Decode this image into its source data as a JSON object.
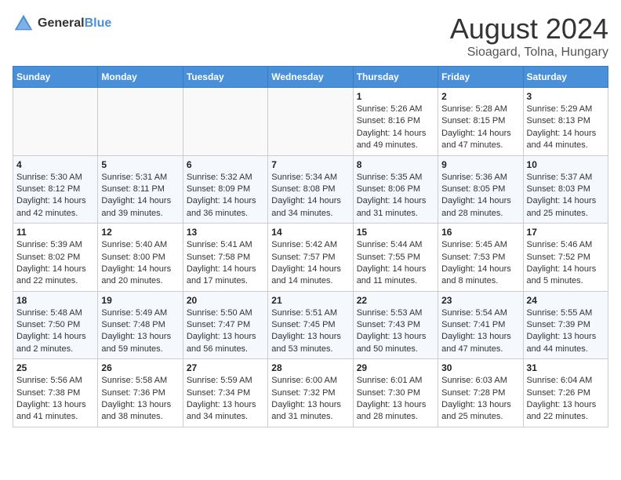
{
  "header": {
    "logo_general": "General",
    "logo_blue": "Blue",
    "title": "August 2024",
    "location": "Sioagard, Tolna, Hungary"
  },
  "weekdays": [
    "Sunday",
    "Monday",
    "Tuesday",
    "Wednesday",
    "Thursday",
    "Friday",
    "Saturday"
  ],
  "weeks": [
    [
      {
        "day": "",
        "info": ""
      },
      {
        "day": "",
        "info": ""
      },
      {
        "day": "",
        "info": ""
      },
      {
        "day": "",
        "info": ""
      },
      {
        "day": "1",
        "info": "Sunrise: 5:26 AM\nSunset: 8:16 PM\nDaylight: 14 hours\nand 49 minutes."
      },
      {
        "day": "2",
        "info": "Sunrise: 5:28 AM\nSunset: 8:15 PM\nDaylight: 14 hours\nand 47 minutes."
      },
      {
        "day": "3",
        "info": "Sunrise: 5:29 AM\nSunset: 8:13 PM\nDaylight: 14 hours\nand 44 minutes."
      }
    ],
    [
      {
        "day": "4",
        "info": "Sunrise: 5:30 AM\nSunset: 8:12 PM\nDaylight: 14 hours\nand 42 minutes."
      },
      {
        "day": "5",
        "info": "Sunrise: 5:31 AM\nSunset: 8:11 PM\nDaylight: 14 hours\nand 39 minutes."
      },
      {
        "day": "6",
        "info": "Sunrise: 5:32 AM\nSunset: 8:09 PM\nDaylight: 14 hours\nand 36 minutes."
      },
      {
        "day": "7",
        "info": "Sunrise: 5:34 AM\nSunset: 8:08 PM\nDaylight: 14 hours\nand 34 minutes."
      },
      {
        "day": "8",
        "info": "Sunrise: 5:35 AM\nSunset: 8:06 PM\nDaylight: 14 hours\nand 31 minutes."
      },
      {
        "day": "9",
        "info": "Sunrise: 5:36 AM\nSunset: 8:05 PM\nDaylight: 14 hours\nand 28 minutes."
      },
      {
        "day": "10",
        "info": "Sunrise: 5:37 AM\nSunset: 8:03 PM\nDaylight: 14 hours\nand 25 minutes."
      }
    ],
    [
      {
        "day": "11",
        "info": "Sunrise: 5:39 AM\nSunset: 8:02 PM\nDaylight: 14 hours\nand 22 minutes."
      },
      {
        "day": "12",
        "info": "Sunrise: 5:40 AM\nSunset: 8:00 PM\nDaylight: 14 hours\nand 20 minutes."
      },
      {
        "day": "13",
        "info": "Sunrise: 5:41 AM\nSunset: 7:58 PM\nDaylight: 14 hours\nand 17 minutes."
      },
      {
        "day": "14",
        "info": "Sunrise: 5:42 AM\nSunset: 7:57 PM\nDaylight: 14 hours\nand 14 minutes."
      },
      {
        "day": "15",
        "info": "Sunrise: 5:44 AM\nSunset: 7:55 PM\nDaylight: 14 hours\nand 11 minutes."
      },
      {
        "day": "16",
        "info": "Sunrise: 5:45 AM\nSunset: 7:53 PM\nDaylight: 14 hours\nand 8 minutes."
      },
      {
        "day": "17",
        "info": "Sunrise: 5:46 AM\nSunset: 7:52 PM\nDaylight: 14 hours\nand 5 minutes."
      }
    ],
    [
      {
        "day": "18",
        "info": "Sunrise: 5:48 AM\nSunset: 7:50 PM\nDaylight: 14 hours\nand 2 minutes."
      },
      {
        "day": "19",
        "info": "Sunrise: 5:49 AM\nSunset: 7:48 PM\nDaylight: 13 hours\nand 59 minutes."
      },
      {
        "day": "20",
        "info": "Sunrise: 5:50 AM\nSunset: 7:47 PM\nDaylight: 13 hours\nand 56 minutes."
      },
      {
        "day": "21",
        "info": "Sunrise: 5:51 AM\nSunset: 7:45 PM\nDaylight: 13 hours\nand 53 minutes."
      },
      {
        "day": "22",
        "info": "Sunrise: 5:53 AM\nSunset: 7:43 PM\nDaylight: 13 hours\nand 50 minutes."
      },
      {
        "day": "23",
        "info": "Sunrise: 5:54 AM\nSunset: 7:41 PM\nDaylight: 13 hours\nand 47 minutes."
      },
      {
        "day": "24",
        "info": "Sunrise: 5:55 AM\nSunset: 7:39 PM\nDaylight: 13 hours\nand 44 minutes."
      }
    ],
    [
      {
        "day": "25",
        "info": "Sunrise: 5:56 AM\nSunset: 7:38 PM\nDaylight: 13 hours\nand 41 minutes."
      },
      {
        "day": "26",
        "info": "Sunrise: 5:58 AM\nSunset: 7:36 PM\nDaylight: 13 hours\nand 38 minutes."
      },
      {
        "day": "27",
        "info": "Sunrise: 5:59 AM\nSunset: 7:34 PM\nDaylight: 13 hours\nand 34 minutes."
      },
      {
        "day": "28",
        "info": "Sunrise: 6:00 AM\nSunset: 7:32 PM\nDaylight: 13 hours\nand 31 minutes."
      },
      {
        "day": "29",
        "info": "Sunrise: 6:01 AM\nSunset: 7:30 PM\nDaylight: 13 hours\nand 28 minutes."
      },
      {
        "day": "30",
        "info": "Sunrise: 6:03 AM\nSunset: 7:28 PM\nDaylight: 13 hours\nand 25 minutes."
      },
      {
        "day": "31",
        "info": "Sunrise: 6:04 AM\nSunset: 7:26 PM\nDaylight: 13 hours\nand 22 minutes."
      }
    ]
  ]
}
